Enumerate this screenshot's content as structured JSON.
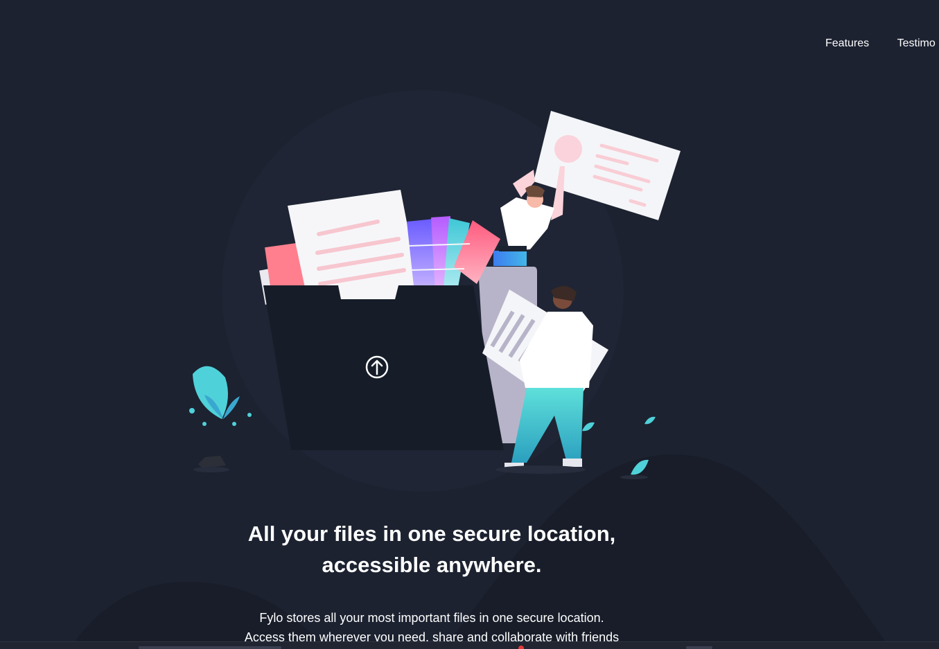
{
  "nav": {
    "items": [
      {
        "label": "Features"
      },
      {
        "label": "Testimo"
      }
    ]
  },
  "hero": {
    "headline_line1": "All your files in one secure location,",
    "headline_line2": "accessible anywhere.",
    "subtext_line1": "Fylo stores all your most important files in one secure location.",
    "subtext_line2": "Access them wherever you need, share and collaborate with friends"
  },
  "illustration": {
    "upload_icon": "upload-arrow-circle-icon",
    "colors": {
      "background": "#1c2230",
      "folder": "#171e2b",
      "accent_teal": "#4fd1d9",
      "accent_pink": "#fa6d86",
      "paper": "#f4f5f8"
    }
  }
}
